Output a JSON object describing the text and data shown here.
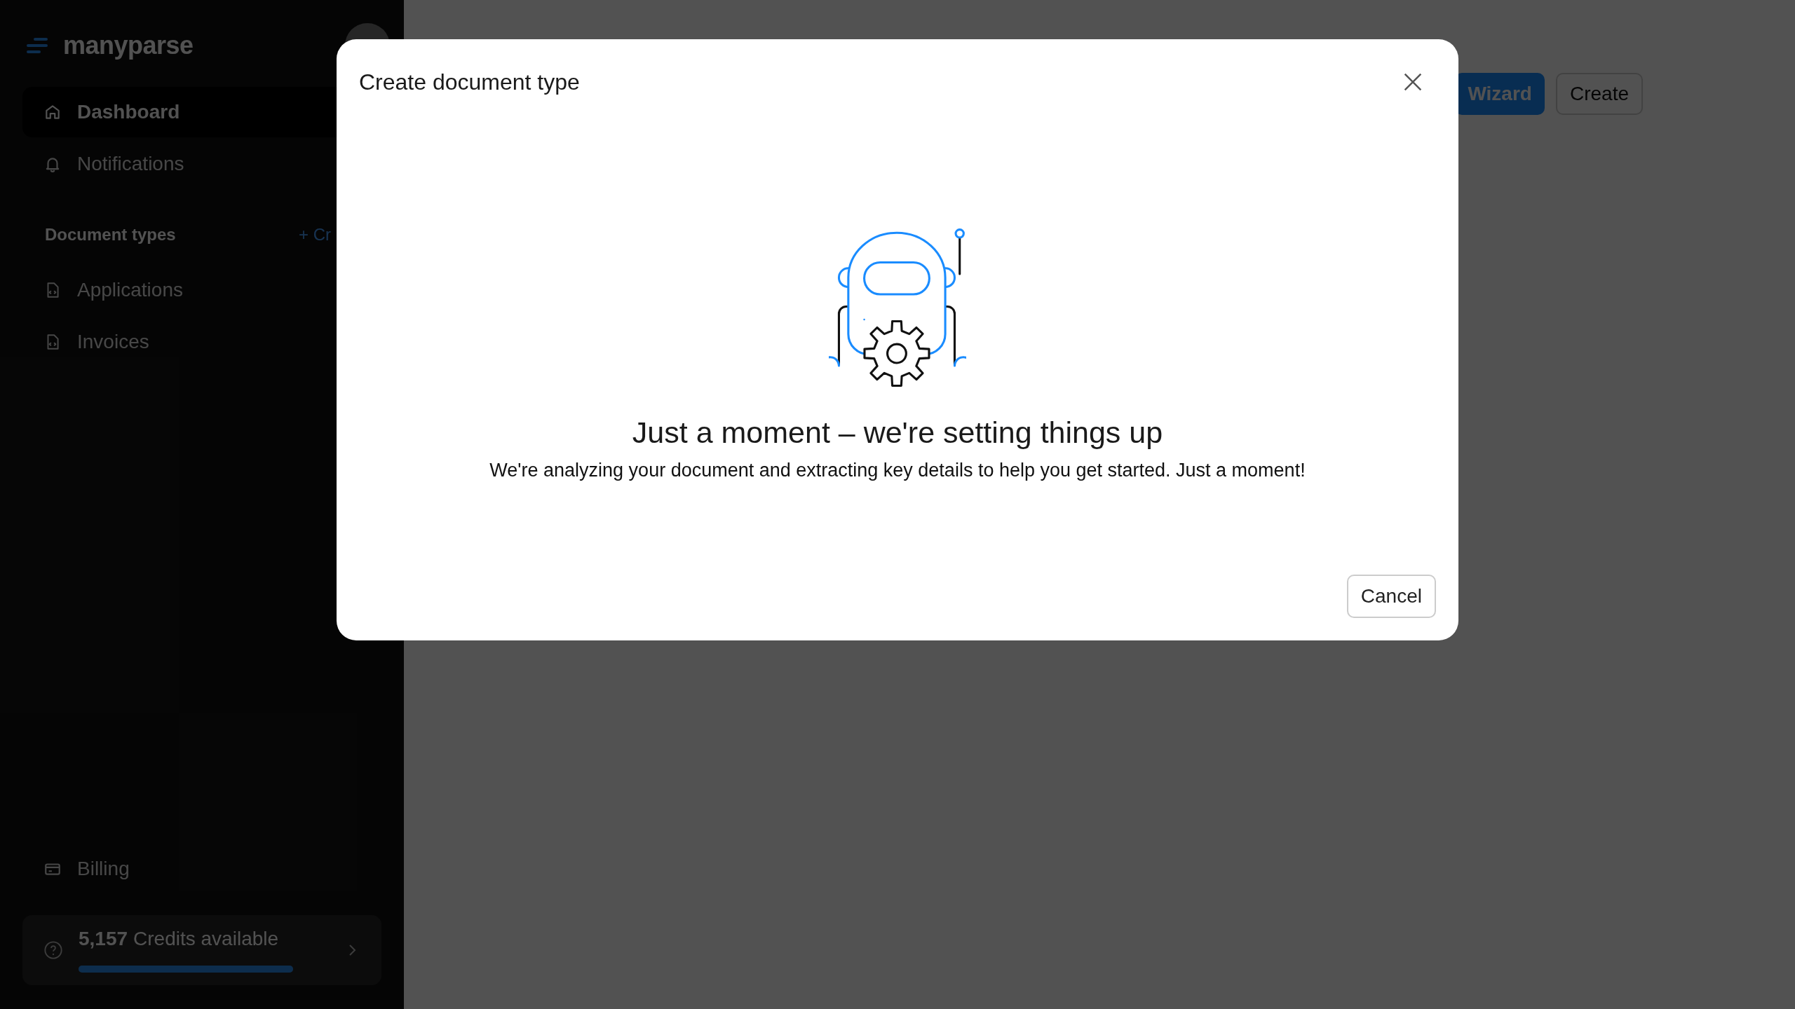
{
  "sidebar": {
    "brand": "manyparse",
    "nav": [
      {
        "label": "Dashboard",
        "selected": true
      },
      {
        "label": "Notifications",
        "selected": false
      }
    ],
    "section": {
      "title": "Document types",
      "action": "+ Cr"
    },
    "document_types": [
      {
        "label": "Applications",
        "selected": false
      },
      {
        "label": "Invoices",
        "selected": false
      }
    ],
    "billing": {
      "label": "Billing"
    },
    "credits": {
      "amount": "5,157",
      "label": "Credits available",
      "level": 1
    }
  },
  "toolbar": {
    "buttons": [
      {
        "label": "Wizard",
        "kind": "primary"
      },
      {
        "label": "Create",
        "kind": "secondary"
      }
    ]
  },
  "dialog": {
    "title": "Create document type",
    "heading": "Just a moment – we're setting things up",
    "message": "We're analyzing your document and extracting key details to help you get started. Just a moment!",
    "buttons": [
      "Cancel"
    ]
  }
}
